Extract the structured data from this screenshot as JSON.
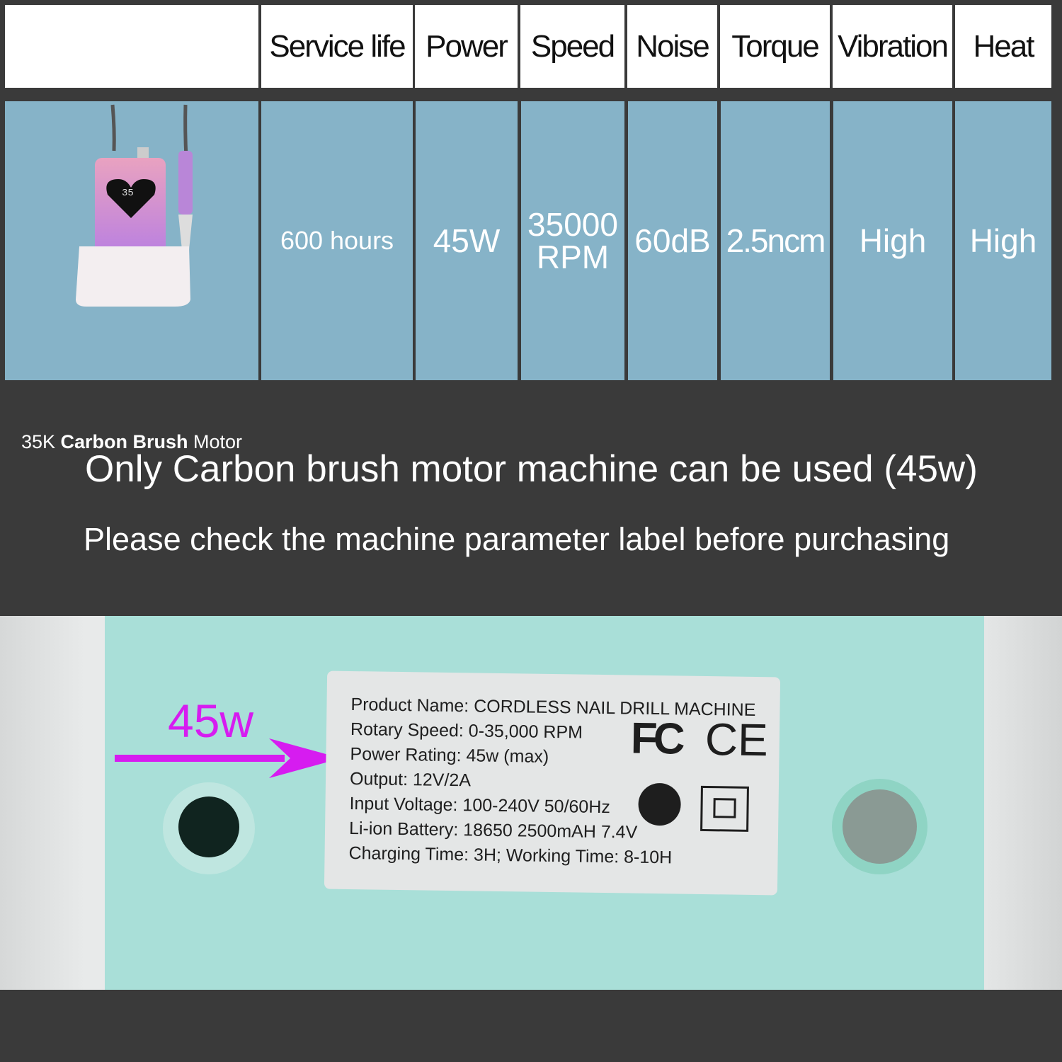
{
  "table": {
    "headers": [
      "",
      "Service life",
      "Power",
      "Speed",
      "Noise",
      "Torque",
      "Vibration",
      "Heat"
    ],
    "product_caption": {
      "prefix": "35K",
      "bold": "Carbon Brush",
      "suffix": "Motor"
    },
    "values": [
      "600 hours",
      "45W",
      "35000 RPM",
      "60dB",
      "2.5ncm",
      "High",
      "High"
    ]
  },
  "notice": {
    "line1": "Only Carbon brush motor machine can be used (45w)",
    "line2": "Please check the machine parameter label before purchasing"
  },
  "photo": {
    "annotation": "45w",
    "annotation_color": "#d61cf0",
    "label_lines": [
      "Product Name: CORDLESS NAIL DRILL MACHINE",
      "Rotary Speed: 0-35,000 RPM",
      "Power Rating: 45w (max)",
      "Output: 12V/2A",
      "Input Voltage: 100-240V 50/60Hz",
      "Li-ion Battery: 18650 2500mAH 7.4V",
      "Charging Time: 3H; Working Time: 8-10H"
    ],
    "marks": [
      "FC",
      "CE"
    ],
    "display_reading": "35"
  }
}
